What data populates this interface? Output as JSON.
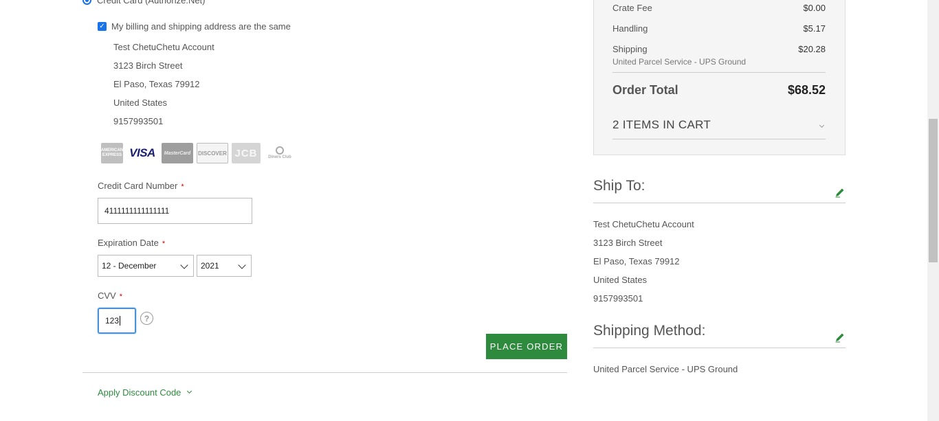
{
  "payment": {
    "method_label": "Credit Card (Authorize.Net)",
    "same_address_label": "My billing and shipping address are the same",
    "billing_address": [
      "Test ChetuChetu Account",
      "3123 Birch Street",
      "El Paso, Texas 79912",
      "United States",
      "9157993501"
    ],
    "card_logos": {
      "amex": "AMERICAN EXPRESS",
      "visa": "VISA",
      "mastercard": "MasterCard",
      "discover": "DISCOVER",
      "jcb": "JCB",
      "diners": "Diners Club"
    },
    "card_number_label": "Credit Card Number",
    "card_number_value": "4111111111111111",
    "expiration_label": "Expiration Date",
    "expiration_month": "12 - December",
    "expiration_year": "2021",
    "cvv_label": "CVV",
    "cvv_value": "123",
    "required_mark": "*",
    "help_glyph": "?",
    "place_order_label": "PLACE ORDER",
    "discount_label": "Apply Discount Code"
  },
  "summary": {
    "crate_fee_label": "Crate Fee",
    "crate_fee_value": "$0.00",
    "handling_label": "Handling",
    "handling_value": "$5.17",
    "shipping_label": "Shipping",
    "shipping_value": "$20.28",
    "shipping_carrier": "United Parcel Service - UPS Ground",
    "order_total_label": "Order Total",
    "order_total_value": "$68.52",
    "items_in_cart": "2 ITEMS IN CART"
  },
  "ship_to": {
    "title": "Ship To:",
    "address": [
      "Test ChetuChetu Account",
      "3123 Birch Street",
      "El Paso, Texas 79912",
      "United States",
      "9157993501"
    ]
  },
  "shipping_method": {
    "title": "Shipping Method:",
    "value": "United Parcel Service - UPS Ground"
  },
  "colors": {
    "accent_green": "#2e8b3e",
    "focus_blue": "#4a90d9"
  }
}
